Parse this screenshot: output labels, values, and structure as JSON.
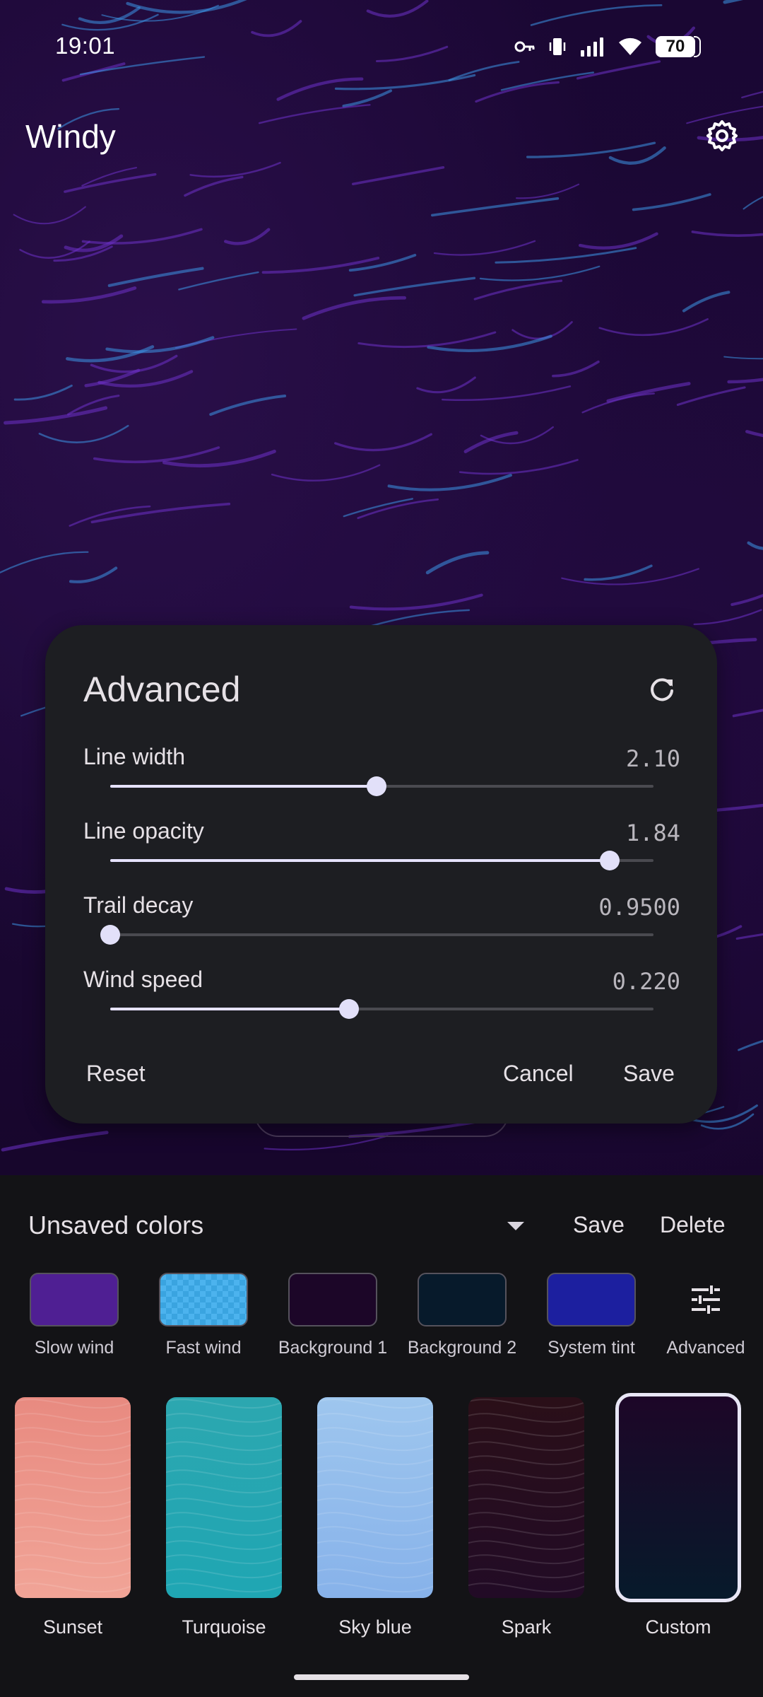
{
  "status_bar": {
    "time": "19:01",
    "battery": "70",
    "icons": [
      "vpn-key-icon",
      "vibrate-icon",
      "signal-icon",
      "wifi-icon",
      "battery-icon"
    ]
  },
  "app": {
    "title": "Windy",
    "settings_icon": "gear-icon"
  },
  "dialog": {
    "title": "Advanced",
    "refresh_icon": "refresh-icon",
    "settings": [
      {
        "label": "Line width",
        "value": "2.10",
        "fraction": 0.49
      },
      {
        "label": "Line opacity",
        "value": "1.84",
        "fraction": 0.92
      },
      {
        "label": "Trail decay",
        "value": "0.9500",
        "fraction": 0.0
      },
      {
        "label": "Wind speed",
        "value": "0.220",
        "fraction": 0.44
      }
    ],
    "reset_label": "Reset",
    "cancel_label": "Cancel",
    "save_label": "Save"
  },
  "palette": {
    "name": "Unsaved colors",
    "save_label": "Save",
    "delete_label": "Delete",
    "swatches": [
      {
        "label": "Slow wind",
        "color": "#4f1f93"
      },
      {
        "label": "Fast wind",
        "color": "#4cb3ee"
      },
      {
        "label": "Background 1",
        "color": "#1c0628"
      },
      {
        "label": "Background 2",
        "color": "#071a2b"
      },
      {
        "label": "System tint",
        "color": "#1c1f9f"
      }
    ],
    "advanced_label": "Advanced",
    "advanced_icon": "tune-icon"
  },
  "themes": [
    {
      "label": "Sunset",
      "color_top": "#e88a80",
      "color_bottom": "#f1a497"
    },
    {
      "label": "Turquoise",
      "color_top": "#2ca7b0",
      "color_bottom": "#1fa6b3"
    },
    {
      "label": "Sky blue",
      "color_top": "#9ec6ee",
      "color_bottom": "#87b2ea"
    },
    {
      "label": "Spark",
      "color_top": "#2a0f18",
      "color_bottom": "#220b26"
    },
    {
      "label": "Custom",
      "color_top": "#1d0628",
      "color_bottom": "#071a2b",
      "selected": true
    }
  ]
}
